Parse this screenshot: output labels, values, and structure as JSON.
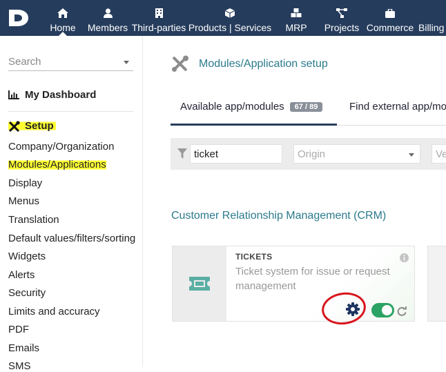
{
  "topbar": {
    "logo_letter": "D",
    "items": [
      {
        "label": "Home",
        "icon": "home-icon"
      },
      {
        "label": "Members",
        "icon": "user-icon"
      },
      {
        "label": "Third-parties",
        "icon": "building-icon"
      },
      {
        "label": "Products | Services",
        "icon": "cube-icon"
      },
      {
        "label": "MRP",
        "icon": "cubes-icon"
      },
      {
        "label": "Projects",
        "icon": "project-diagram-icon"
      },
      {
        "label": "Commerce",
        "icon": "suitcase-icon"
      },
      {
        "label": "Billing",
        "icon": "billing-icon"
      }
    ],
    "active_item": "Home",
    "bg_color": "#263c5c"
  },
  "sidebar": {
    "search_placeholder": "Search",
    "dashboard_label": "My Dashboard",
    "setup_label": "Setup",
    "items": [
      "Company/Organization",
      "Modules/Applications",
      "Display",
      "Menus",
      "Translation",
      "Default values/filters/sorting",
      "Widgets",
      "Alerts",
      "Security",
      "Limits and accuracy",
      "PDF",
      "Emails",
      "SMS"
    ],
    "highlight_color": "#ffff33"
  },
  "main": {
    "page_title": "Modules/Application setup",
    "tabs": [
      {
        "label": "Available app/modules",
        "badge": "67 / 89"
      },
      {
        "label": "Find external app/mod"
      }
    ],
    "filters": {
      "search_value": "ticket",
      "origin_placeholder": "Origin",
      "third_placeholder": "Ve"
    },
    "section_title": "Customer Relationship Management (CRM)",
    "module": {
      "name": "TICKETS",
      "description": "Ticket system for issue or request management",
      "enabled": true,
      "icon": "ticket-icon"
    },
    "accent_color": "#2b7a8c",
    "toggle_color": "#2aa364",
    "annotation_color": "#d8141c"
  }
}
